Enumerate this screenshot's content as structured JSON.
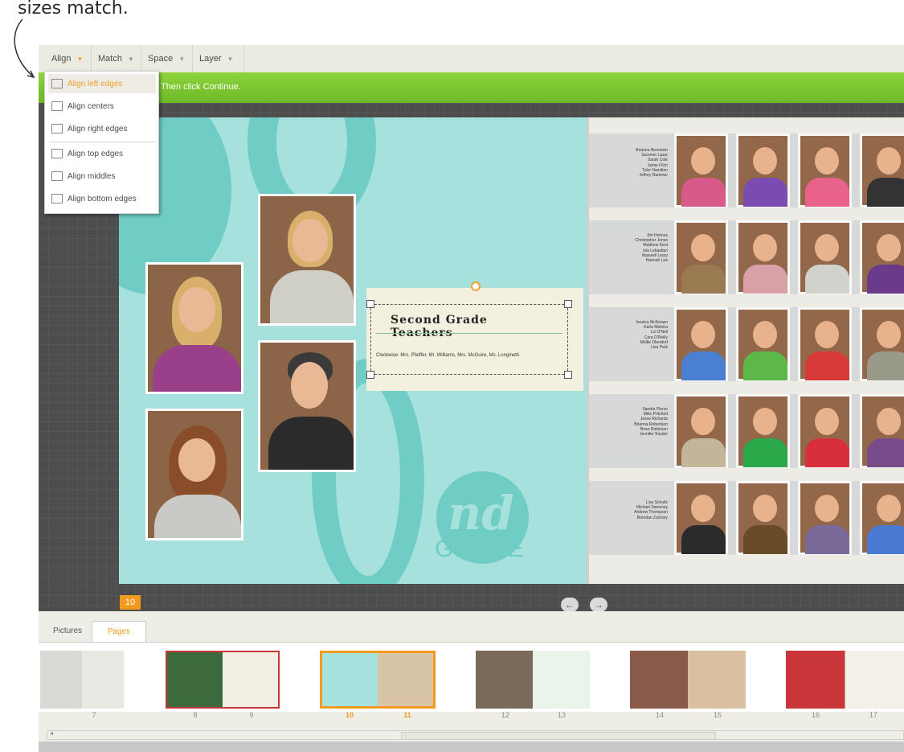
{
  "annotation": {
    "text": "sizes match."
  },
  "menubar": {
    "items": [
      {
        "label": "Align"
      },
      {
        "label": "Match"
      },
      {
        "label": "Space"
      },
      {
        "label": "Layer"
      }
    ]
  },
  "instruction": {
    "text": "Then click Continue."
  },
  "dropdown": {
    "items": [
      {
        "label": "Align left edges",
        "icon": "align-left-icon",
        "highlighted": true
      },
      {
        "label": "Align centers",
        "icon": "align-center-icon"
      },
      {
        "label": "Align right edges",
        "icon": "align-right-icon"
      },
      {
        "label": "Align top edges",
        "icon": "align-top-icon"
      },
      {
        "label": "Align middles",
        "icon": "align-middle-icon"
      },
      {
        "label": "Align bottom edges",
        "icon": "align-bottom-icon"
      }
    ]
  },
  "textbox": {
    "title": "Second Grade Teachers",
    "body": "Clockwise: Mrs. Pfeiffer, Mr. Williams, Mrs. McGuire, Ms. Longinetti"
  },
  "logo": {
    "mark": "nd",
    "word": "GRADE"
  },
  "rows": [
    {
      "names": [
        "Brianna Bernstein",
        "Summer Lazar",
        "Sarah Cole",
        "Jamie Fitch",
        "Tyler Hamilton",
        "Jeffrey Rammer"
      ]
    },
    {
      "names": [
        "Jim Holmes",
        "Christopher Jones",
        "Matthew Kent",
        "Isla Lebastian",
        "Maxwell Leary",
        "Hannah Lee"
      ]
    },
    {
      "names": [
        "Jessica McKeown",
        "Karla Moletra",
        "Liz O'Neil",
        "Cara O'Reilly",
        "Mollie Oberdorf",
        "Lisa Park"
      ]
    },
    {
      "names": [
        "Sandra Pierce",
        "Mike Pritchett",
        "Jesse Richards",
        "Brianna Robertson",
        "Brian Robinson",
        "Jennifer Snyder"
      ]
    },
    {
      "names": [
        "Lisa Schultz",
        "Michael Sweeney",
        "Andrew Thompson",
        "Brendan Zachary"
      ]
    }
  ],
  "page_number": "10",
  "nav": {
    "prev": "←",
    "next": "→"
  },
  "tabs": [
    {
      "label": "Pictures"
    },
    {
      "label": "Pages"
    }
  ],
  "thumbnails": {
    "numbers": [
      "7",
      "8",
      "9",
      "10",
      "11",
      "12",
      "13",
      "14",
      "15",
      "16",
      "17"
    ],
    "selected": [
      "10",
      "11"
    ]
  },
  "colors": {
    "accent_orange": "#f29a1e",
    "green_bar": "#7cc62f",
    "teal": "#a6e1dd"
  }
}
